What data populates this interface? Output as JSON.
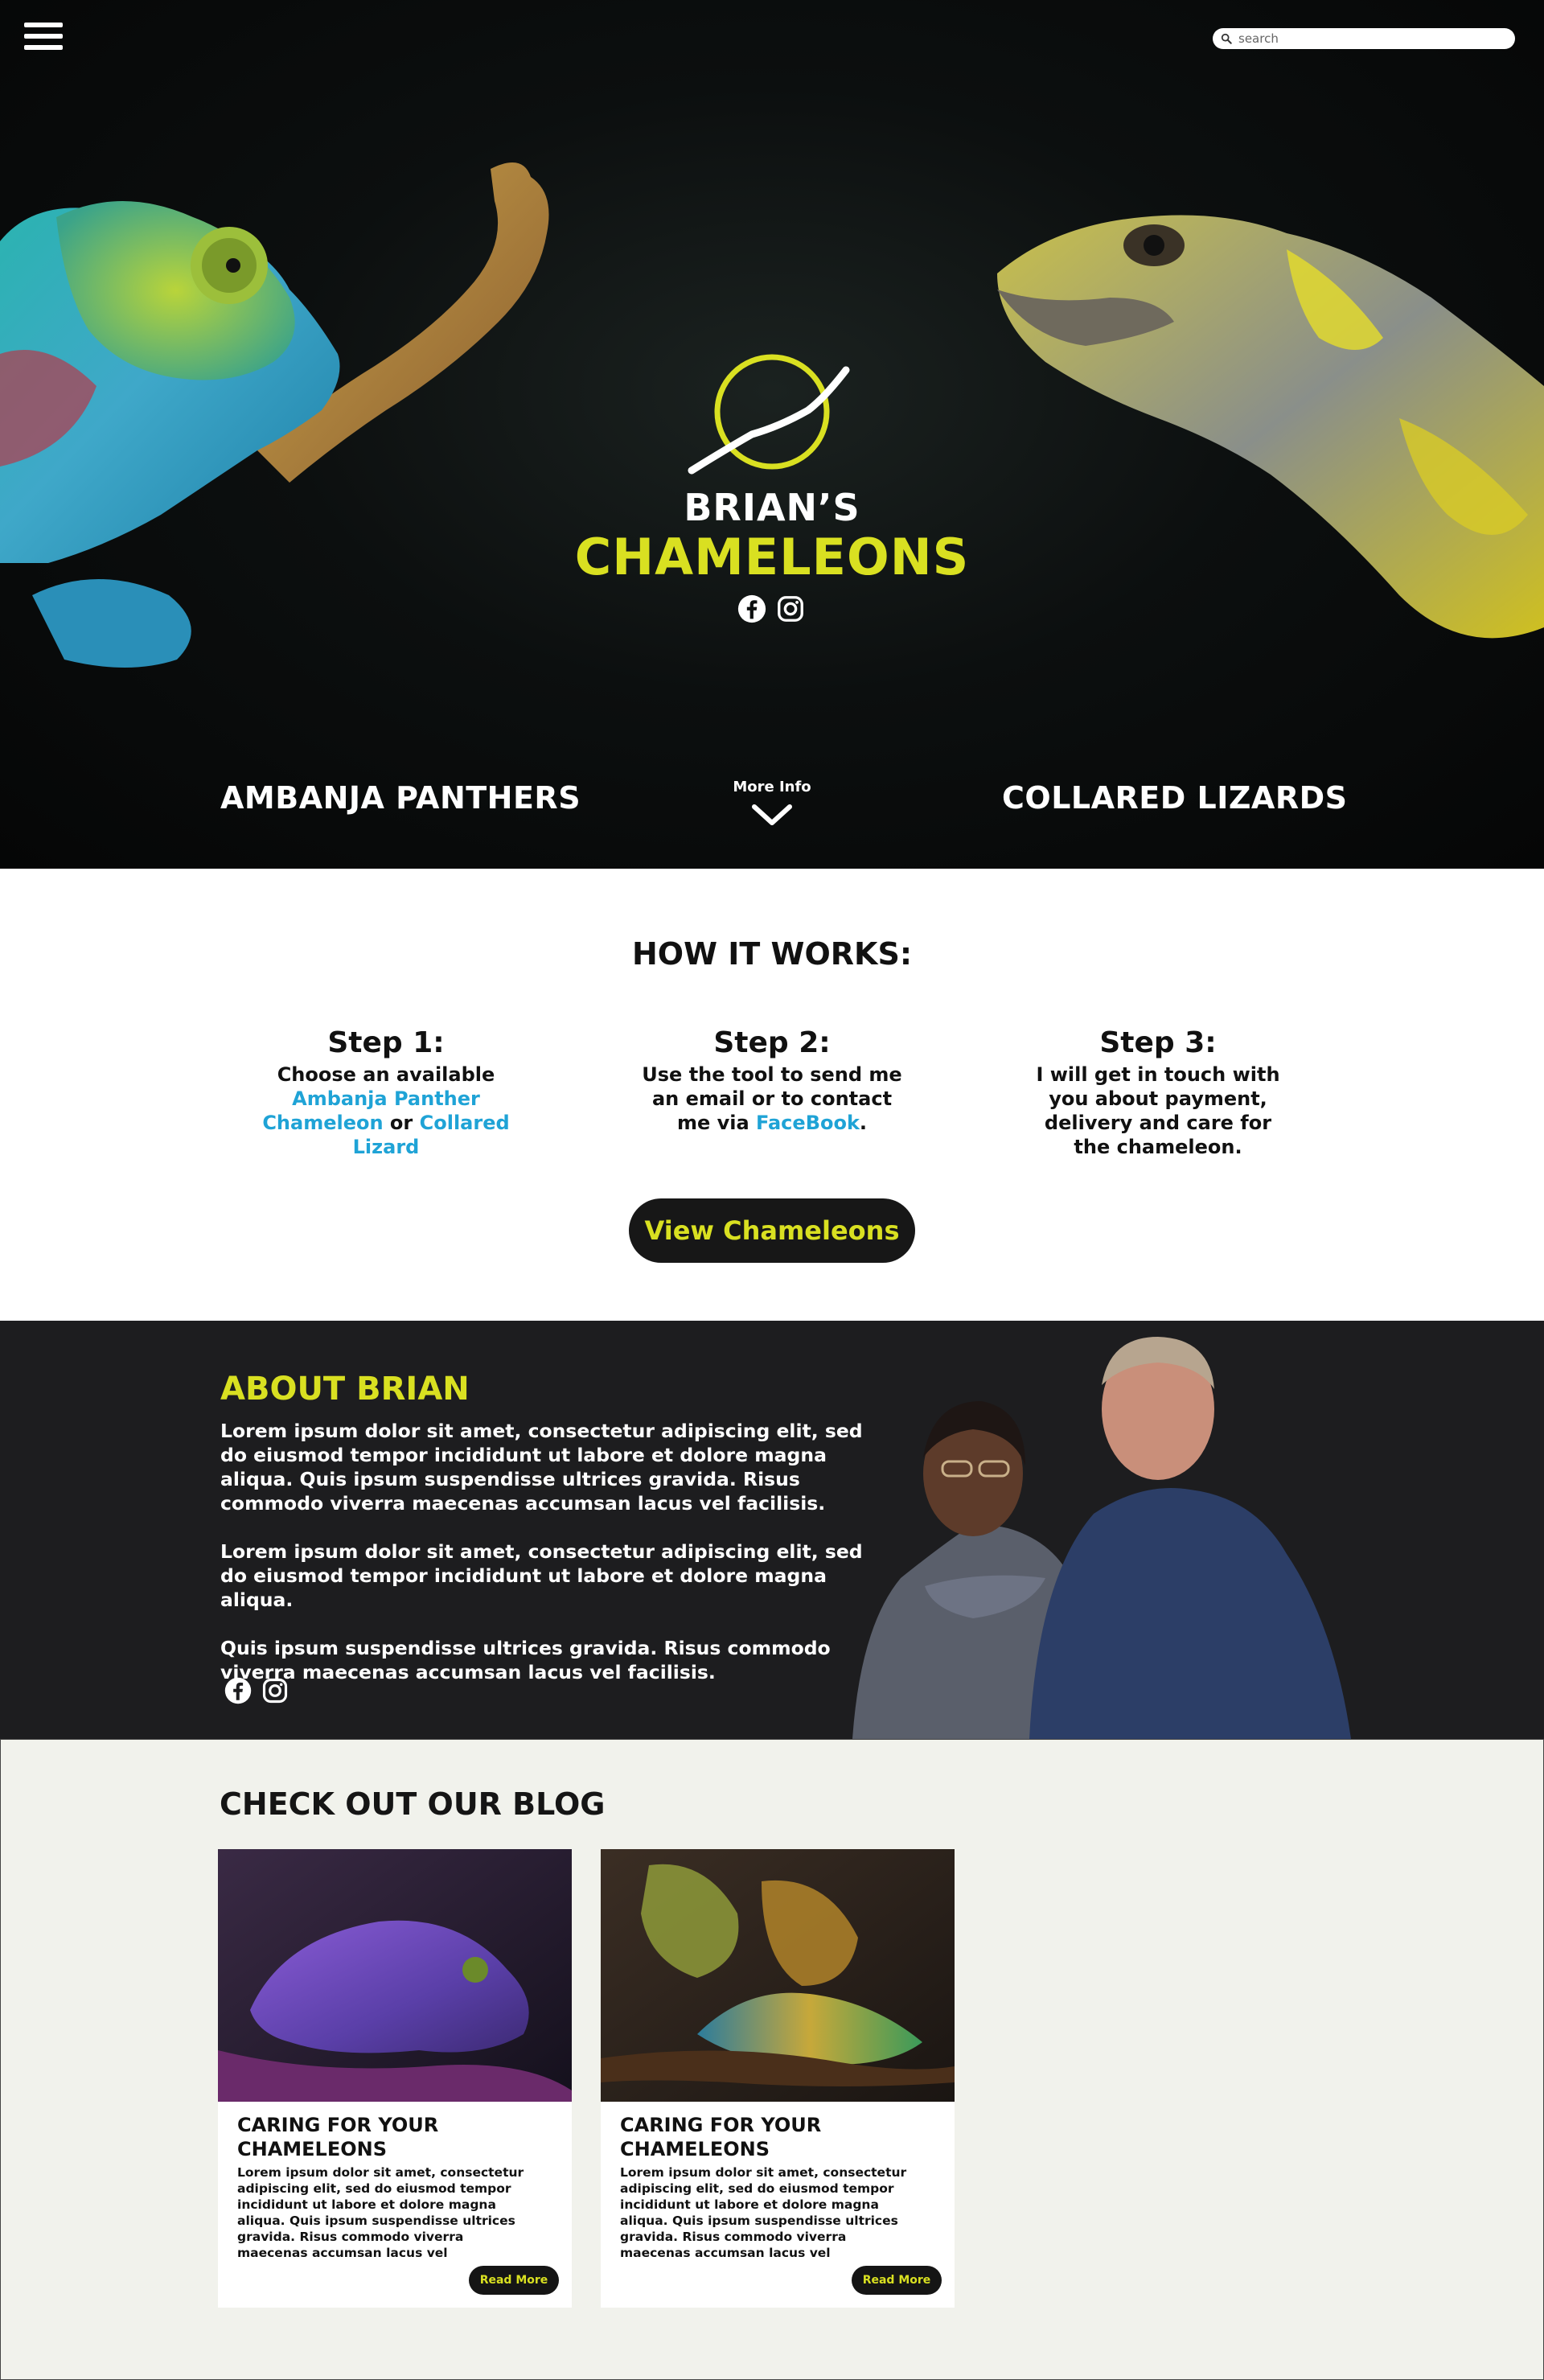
{
  "colors": {
    "accent": "#d9e021",
    "link": "#1fa3d6",
    "dark": "#1d1d1f",
    "blog_bg": "#f1f2ec"
  },
  "header": {
    "menu_icon": "hamburger-menu-icon",
    "search": {
      "placeholder": "search",
      "icon": "search-icon"
    }
  },
  "hero": {
    "brand_top": "BRIAN’S",
    "brand_main": "CHAMELEONS",
    "social": [
      "facebook-icon",
      "instagram-icon"
    ],
    "left_link": "AMBANJA PANTHERS",
    "right_link": "COLLARED LIZARDS",
    "more_info": "More Info"
  },
  "how": {
    "title": "HOW IT WORKS:",
    "steps": [
      {
        "title": "Step 1:",
        "text_a": "Choose an available ",
        "link_a": "Ambanja Panther Chameleon",
        "text_b": " or ",
        "link_b": "Collared Lizard"
      },
      {
        "title": "Step 2:",
        "text_a": "Use the tool to send me an email or to contact me via ",
        "link_a": "FaceBook",
        "text_b": "."
      },
      {
        "title": "Step 3:",
        "text_a": "I will get in touch with you about payment, delivery and care for the chameleon."
      }
    ],
    "cta": "View Chameleons"
  },
  "about": {
    "title": "ABOUT BRIAN",
    "paragraphs": [
      "Lorem ipsum dolor sit amet, consectetur adipiscing elit, sed do eiusmod tempor incididunt ut labore et dolore magna aliqua. Quis ipsum suspendisse ultrices gravida. Risus commodo viverra maecenas accumsan lacus vel facilisis.",
      "Lorem ipsum dolor sit amet, consectetur adipiscing elit, sed do eiusmod tempor incididunt ut labore et dolore magna aliqua.",
      "Quis ipsum suspendisse ultrices gravida. Risus commodo viverra maecenas accumsan lacus vel facilisis."
    ]
  },
  "blog": {
    "title": "CHECK OUT OUR BLOG",
    "posts": [
      {
        "title": "CARING FOR YOUR CHAMELEONS",
        "text": "Lorem ipsum dolor sit amet, consectetur adipiscing elit, sed do eiusmod tempor incididunt ut labore et dolore magna aliqua. Quis ipsum suspendisse ultrices gravida. Risus commodo viverra maecenas accumsan lacus vel",
        "button": "Read More"
      },
      {
        "title": "CARING FOR YOUR CHAMELEONS",
        "text": "Lorem ipsum dolor sit amet, consectetur adipiscing elit, sed do eiusmod tempor incididunt ut labore et dolore magna aliqua. Quis ipsum suspendisse ultrices gravida. Risus commodo viverra maecenas accumsan lacus vel",
        "button": "Read More"
      }
    ]
  }
}
